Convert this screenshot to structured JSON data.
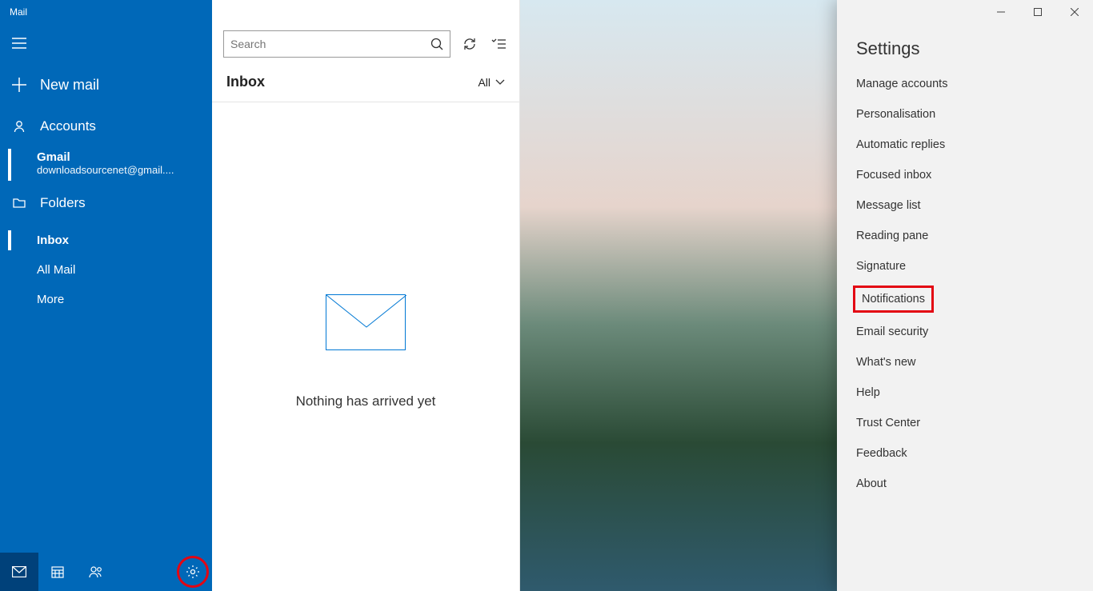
{
  "app_title": "Mail",
  "sidebar": {
    "new_mail": "New mail",
    "accounts_header": "Accounts",
    "account": {
      "name": "Gmail",
      "email": "downloadsourcenet@gmail...."
    },
    "folders_header": "Folders",
    "folders": [
      "Inbox",
      "All Mail",
      "More"
    ],
    "selected_folder_index": 0
  },
  "search": {
    "placeholder": "Search"
  },
  "messagelist": {
    "title": "Inbox",
    "filter": "All",
    "empty_message": "Nothing has arrived yet"
  },
  "settings": {
    "title": "Settings",
    "items": [
      "Manage accounts",
      "Personalisation",
      "Automatic replies",
      "Focused inbox",
      "Message list",
      "Reading pane",
      "Signature",
      "Notifications",
      "Email security",
      "What's new",
      "Help",
      "Trust Center",
      "Feedback",
      "About"
    ],
    "highlighted_index": 7
  }
}
